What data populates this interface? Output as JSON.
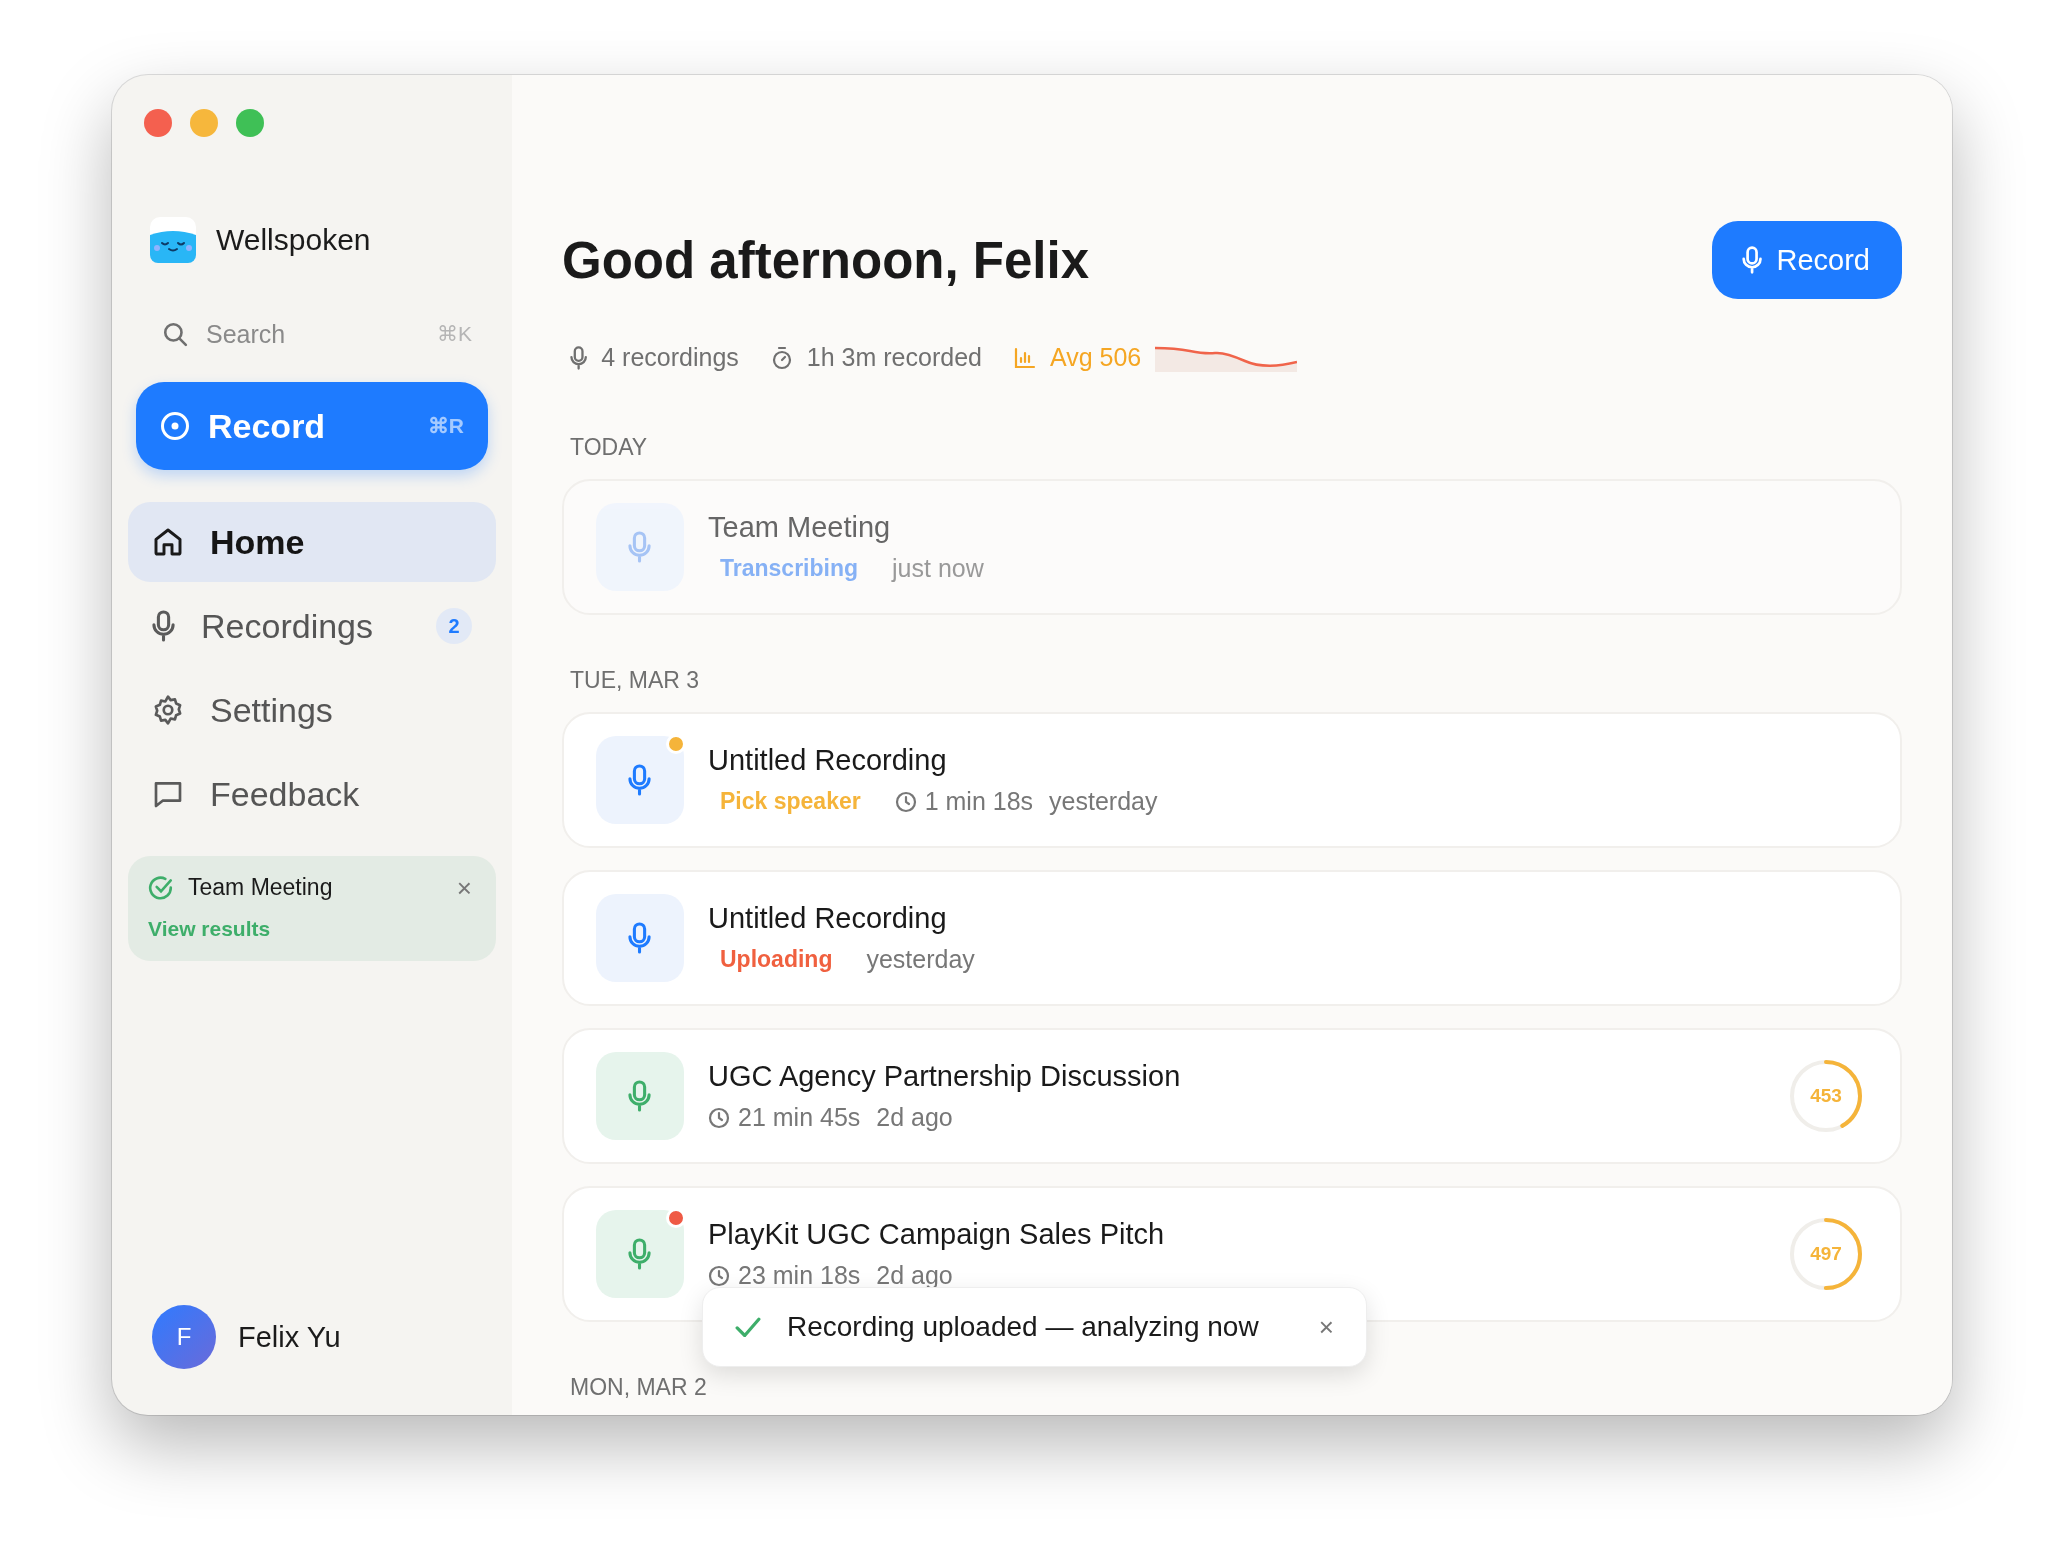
{
  "app": {
    "name": "Wellspoken"
  },
  "search": {
    "placeholder": "Search",
    "shortcut": "⌘K"
  },
  "record_button": {
    "label": "Record",
    "shortcut": "⌘R"
  },
  "nav": [
    {
      "label": "Home",
      "selected": true
    },
    {
      "label": "Recordings",
      "selected": false,
      "badge": "2"
    },
    {
      "label": "Settings",
      "selected": false
    },
    {
      "label": "Feedback",
      "selected": false
    }
  ],
  "notice": {
    "title": "Team Meeting",
    "link": "View results",
    "close": "×"
  },
  "user": {
    "initial": "F",
    "name": "Felix Yu"
  },
  "header": {
    "title": "Good afternoon, Felix",
    "button": "Record"
  },
  "stats": [
    {
      "text": "4 recordings",
      "kind": "plain"
    },
    {
      "text": "1h 3m recorded",
      "kind": "plain"
    },
    {
      "text": "Avg 506",
      "kind": "accent"
    }
  ],
  "sections": [
    {
      "label": "TODAY",
      "items": [
        {
          "title": "Team Meeting",
          "kind": "pending",
          "dimmed": true,
          "status": {
            "text": "Transcribing",
            "kind": "transcribing"
          },
          "time": "just now"
        }
      ]
    },
    {
      "label": "TUE, MAR 3",
      "items": [
        {
          "title": "Untitled Recording",
          "kind": "pending",
          "dimmed": false,
          "dot": {
            "color": "#f5b43a"
          },
          "status": {
            "text": "Pick speaker",
            "kind": "pick"
          },
          "duration": "1 min 18s",
          "time": "yesterday"
        },
        {
          "title": "Untitled Recording",
          "kind": "pending",
          "dimmed": false,
          "status": {
            "text": "Uploading",
            "kind": "uploading"
          },
          "time": "yesterday"
        },
        {
          "title": "UGC Agency Partnership Discussion",
          "kind": "done",
          "dimmed": false,
          "duration": "21 min 45s",
          "time": "2d ago",
          "score": {
            "text": "453",
            "level": 0.42
          }
        },
        {
          "title": "PlayKit UGC Campaign Sales Pitch",
          "kind": "done",
          "dimmed": false,
          "dot": {
            "color": "#ef5a45"
          },
          "duration": "23 min 18s",
          "time": "2d ago",
          "score": {
            "text": "497",
            "level": 0.5
          }
        }
      ]
    },
    {
      "label": "MON, MAR 2"
    }
  ],
  "toast": {
    "text": "Recording uploaded — analyzing now",
    "close": "×"
  }
}
